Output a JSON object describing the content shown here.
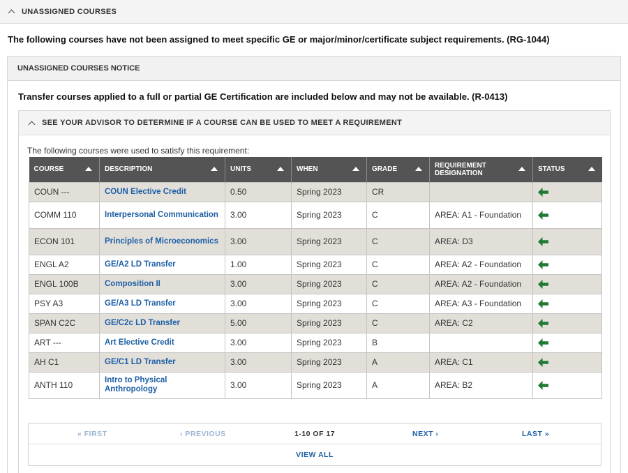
{
  "section": {
    "title": "UNASSIGNED COURSES"
  },
  "intro_text": "The following courses have not been assigned to meet specific GE or major/minor/certificate subject requirements. (RG-1044)",
  "notice": {
    "title": "UNASSIGNED COURSES NOTICE",
    "text": "Transfer courses applied to a full or partial GE Certification are included below and may not be available. (R-0413)"
  },
  "advisor": {
    "title": "SEE YOUR ADVISOR TO DETERMINE IF A COURSE CAN BE USED TO MEET A REQUIREMENT",
    "used_text": "The following courses were used to satisfy this requirement:"
  },
  "table": {
    "headers": {
      "course": "COURSE",
      "description": "DESCRIPTION",
      "units": "UNITS",
      "when": "WHEN",
      "grade": "GRADE",
      "requirement": "REQUIREMENT DESIGNATION",
      "status": "STATUS"
    },
    "rows": [
      {
        "course": "COUN ---",
        "description": "COUN Elective Credit",
        "units": "0.50",
        "when": "Spring 2023",
        "grade": "CR",
        "requirement": "",
        "status": "left-arrow-icon"
      },
      {
        "course": "COMM 110",
        "description": "Interpersonal Communication",
        "units": "3.00",
        "when": "Spring 2023",
        "grade": "C",
        "requirement": "AREA: A1 - Foundation",
        "status": "left-arrow-icon"
      },
      {
        "course": "ECON 101",
        "description": "Principles of Microeconomics",
        "units": "3.00",
        "when": "Spring 2023",
        "grade": "C",
        "requirement": "AREA: D3",
        "status": "left-arrow-icon"
      },
      {
        "course": "ENGL A2",
        "description": "GE/A2 LD Transfer",
        "units": "1.00",
        "when": "Spring 2023",
        "grade": "C",
        "requirement": "AREA: A2 - Foundation",
        "status": "left-arrow-icon"
      },
      {
        "course": "ENGL 100B",
        "description": "Composition II",
        "units": "3.00",
        "when": "Spring 2023",
        "grade": "C",
        "requirement": "AREA: A2 - Foundation",
        "status": "left-arrow-icon"
      },
      {
        "course": "PSY A3",
        "description": "GE/A3 LD Transfer",
        "units": "3.00",
        "when": "Spring 2023",
        "grade": "C",
        "requirement": "AREA: A3 - Foundation",
        "status": "left-arrow-icon"
      },
      {
        "course": "SPAN C2C",
        "description": "GE/C2c LD Transfer",
        "units": "5.00",
        "when": "Spring 2023",
        "grade": "C",
        "requirement": "AREA: C2",
        "status": "left-arrow-icon"
      },
      {
        "course": "ART ---",
        "description": "Art Elective Credit",
        "units": "3.00",
        "when": "Spring 2023",
        "grade": "B",
        "requirement": "",
        "status": "left-arrow-icon"
      },
      {
        "course": "AH C1",
        "description": "GE/C1 LD Transfer",
        "units": "3.00",
        "when": "Spring 2023",
        "grade": "A",
        "requirement": "AREA: C1",
        "status": "left-arrow-icon"
      },
      {
        "course": "ANTH 110",
        "description": "Intro to Physical Anthropology",
        "units": "3.00",
        "when": "Spring 2023",
        "grade": "A",
        "requirement": "AREA: B2",
        "status": "left-arrow-icon"
      }
    ]
  },
  "pagination": {
    "first": "« FIRST",
    "previous": "‹ PREVIOUS",
    "count": "1-10 OF 17",
    "next": "NEXT ›",
    "last": "LAST »",
    "view_all": "VIEW ALL"
  },
  "colors": {
    "header_bg": "#545454",
    "shaded_row": "#e2dfd9",
    "link": "#1d5fa6",
    "status_arrow": "#1f7a34"
  }
}
